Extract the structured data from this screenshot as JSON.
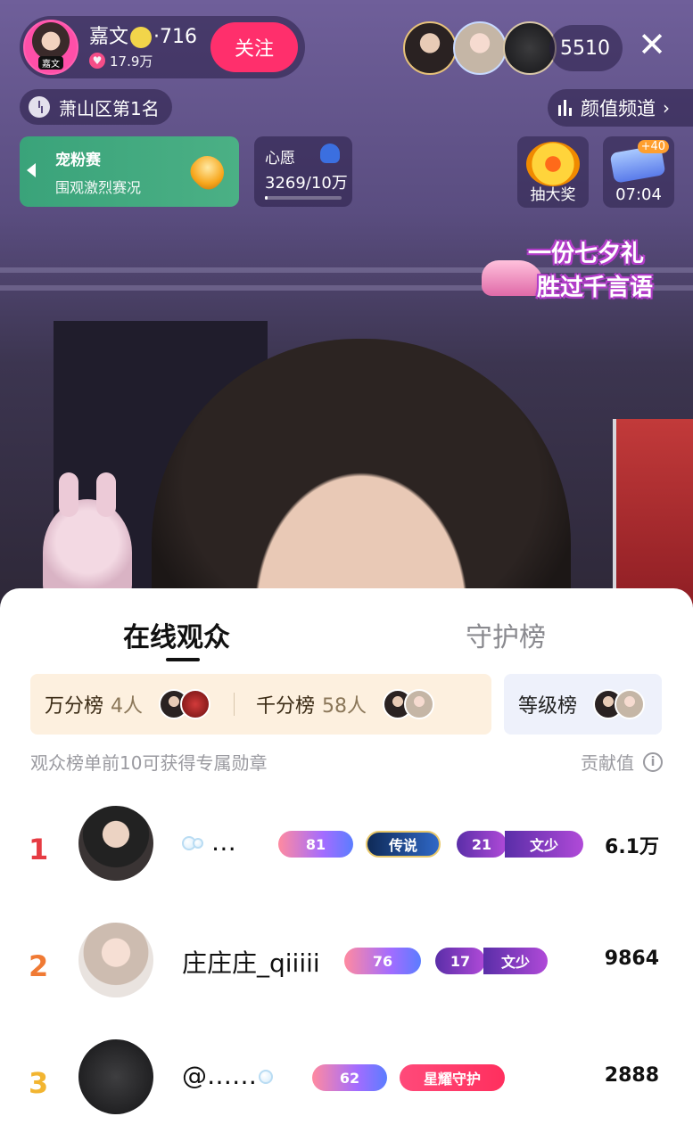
{
  "host": {
    "name": "嘉文",
    "level": "·716",
    "avatar_tag": "嘉文",
    "likes": "17.9万",
    "follow_label": "关注"
  },
  "viewers": {
    "count": "5510"
  },
  "rank_pill": {
    "label": "萧山区第1名"
  },
  "channel": {
    "label": "颜值频道"
  },
  "fan_card": {
    "title": "宠粉赛",
    "subtitle": "围观激烈赛况"
  },
  "wish": {
    "title": "心愿",
    "value": "3269/10万",
    "progress": 0.033
  },
  "lottery": {
    "label": "抽大奖"
  },
  "popular": {
    "badge": "+40",
    "time": "07:04"
  },
  "promo": {
    "line1": "一份七夕礼",
    "line2": "胜过千言语"
  },
  "sheet": {
    "tabs": [
      {
        "label": "在线观众",
        "active": true
      },
      {
        "label": "守护榜",
        "active": false
      }
    ],
    "boards": {
      "wan_label": "万分榜",
      "wan_count": "4人",
      "qian_label": "千分榜",
      "qian_count": "58人",
      "level_label": "等级榜"
    },
    "hint": "观众榜单前10可获得专属勋章",
    "contrib_label": "贡献值"
  },
  "audience": [
    {
      "rank": "1",
      "name": "…",
      "badges": [
        "81",
        "传说",
        "21",
        "文少"
      ],
      "value": "6.1万"
    },
    {
      "rank": "2",
      "name": "庄庄庄_qiiiii",
      "badges": [
        "76",
        "17",
        "文少"
      ],
      "value": "9864"
    },
    {
      "rank": "3",
      "name": "@……",
      "badges": [
        "62",
        "星耀守护"
      ],
      "value": "2888"
    }
  ]
}
